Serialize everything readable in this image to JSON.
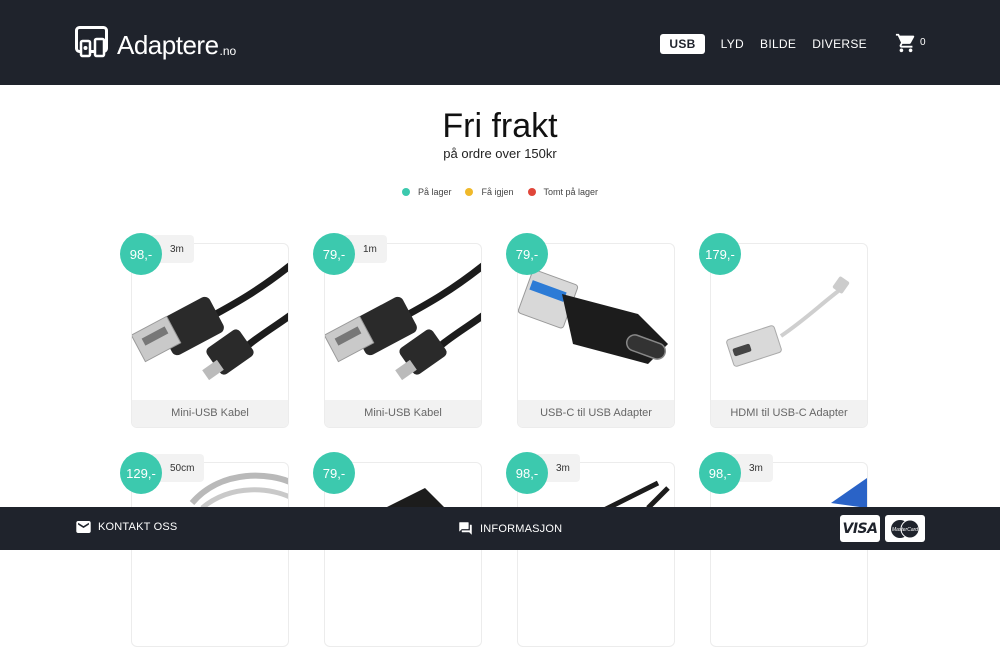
{
  "header": {
    "logo_text": "Adaptere",
    "logo_tld": ".no",
    "nav": [
      {
        "label": "USB",
        "active": true
      },
      {
        "label": "LYD",
        "active": false
      },
      {
        "label": "BILDE",
        "active": false
      },
      {
        "label": "DIVERSE",
        "active": false
      }
    ],
    "cart_count": "0"
  },
  "hero": {
    "title": "Fri frakt",
    "subtitle": "på ordre over 150kr"
  },
  "legend": [
    {
      "label": "På lager",
      "color": "#3cc9ae"
    },
    {
      "label": "Få igjen",
      "color": "#f0b92a"
    },
    {
      "label": "Tomt på lager",
      "color": "#e0463a"
    }
  ],
  "products": [
    {
      "price": "98,-",
      "length": "3m",
      "name": "Mini-USB Kabel",
      "image": "mini-usb-cable"
    },
    {
      "price": "79,-",
      "length": "1m",
      "name": "Mini-USB Kabel",
      "image": "mini-usb-cable"
    },
    {
      "price": "79,-",
      "length": "",
      "name": "USB-C til USB Adapter",
      "image": "usb-c-adapter"
    },
    {
      "price": "179,-",
      "length": "",
      "name": "HDMI til USB-C Adapter",
      "image": "hdmi-usb-c-adapter"
    },
    {
      "price": "129,-",
      "length": "50cm",
      "name": "",
      "image": "braided-cable"
    },
    {
      "price": "79,-",
      "length": "",
      "name": "",
      "image": "black-adapter"
    },
    {
      "price": "98,-",
      "length": "3m",
      "name": "",
      "image": "cable"
    },
    {
      "price": "98,-",
      "length": "3m",
      "name": "",
      "image": "blue-connector"
    }
  ],
  "footer": {
    "contact_label": "KONTAKT OSS",
    "info_label": "INFORMASJON",
    "payment": [
      "VISA",
      "MasterCard"
    ]
  },
  "colors": {
    "header_bg": "#1f232c",
    "accent": "#3cc9ae"
  }
}
